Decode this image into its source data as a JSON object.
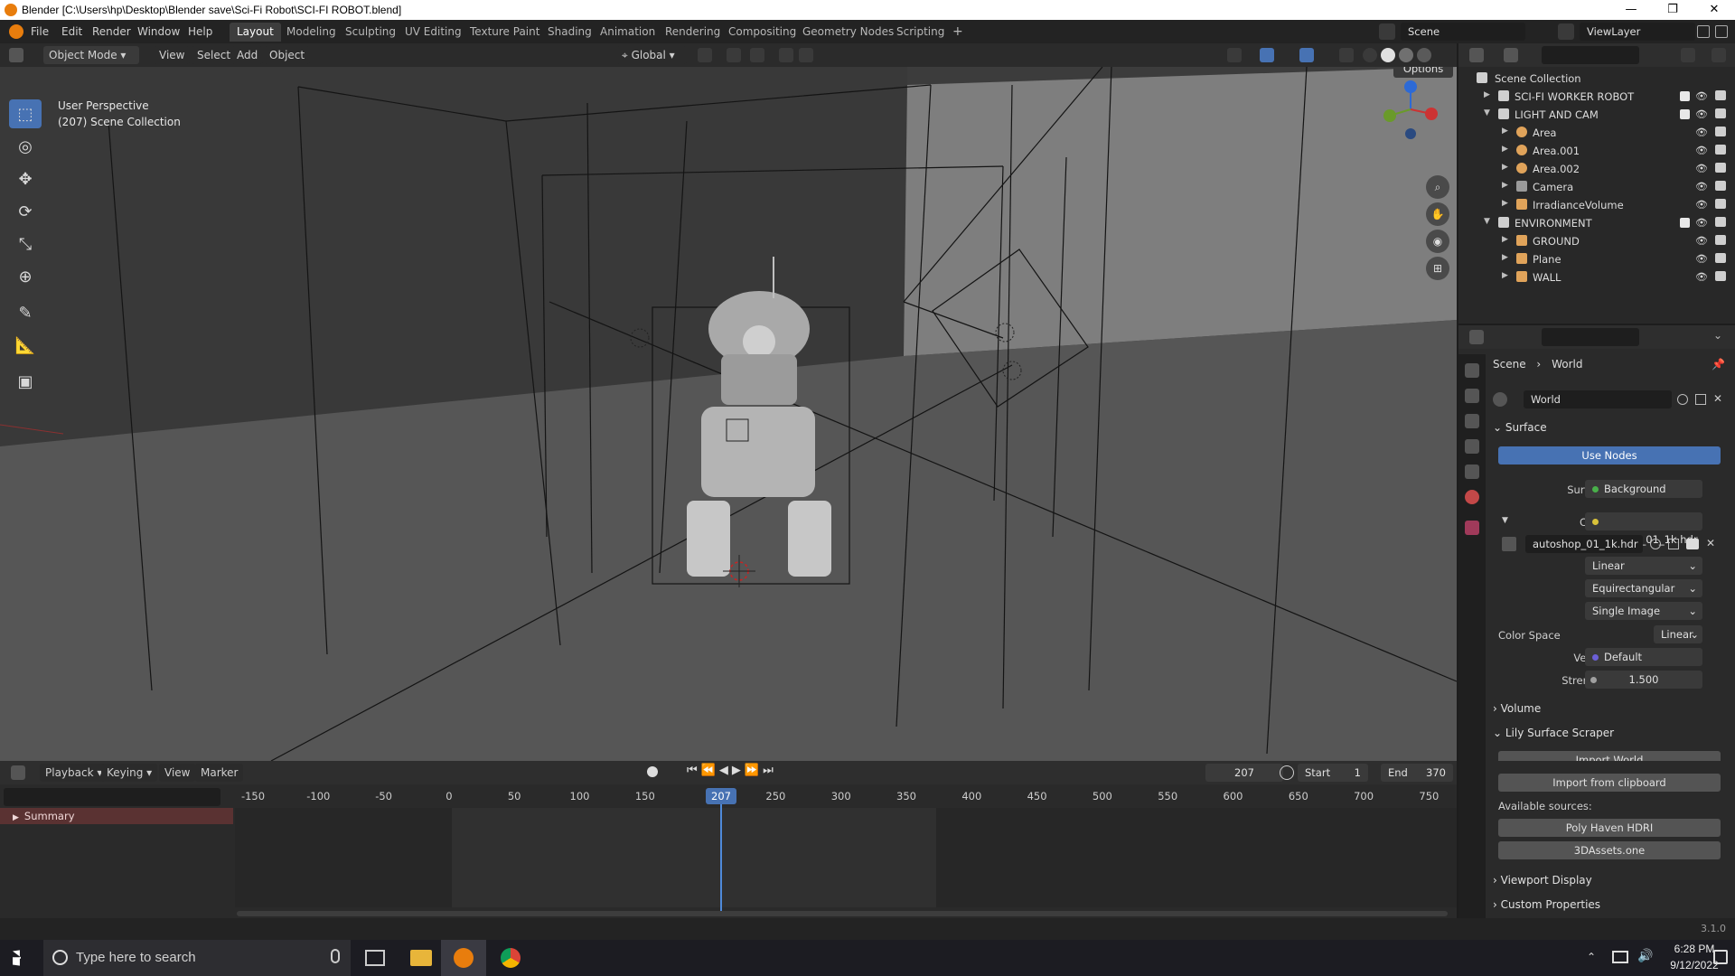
{
  "window": {
    "title": "Blender [C:\\Users\\hp\\Desktop\\Blender save\\Sci-Fi Robot\\SCI-FI ROBOT.blend]",
    "min_label": "—",
    "max_label": "❐",
    "close_label": "✕"
  },
  "menu": {
    "items": [
      "File",
      "Edit",
      "Render",
      "Window",
      "Help"
    ]
  },
  "workspaces": {
    "tabs": [
      "Layout",
      "Modeling",
      "Sculpting",
      "UV Editing",
      "Texture Paint",
      "Shading",
      "Animation",
      "Rendering",
      "Compositing",
      "Geometry Nodes",
      "Scripting"
    ],
    "add": "+",
    "active": "Layout"
  },
  "topright": {
    "scene": "Scene",
    "viewlayer": "ViewLayer"
  },
  "viewport_header": {
    "mode": "Object Mode",
    "view": "View",
    "select": "Select",
    "add": "Add",
    "object": "Object",
    "transform": "Global",
    "options": "Options"
  },
  "viewport": {
    "perspective": "User Perspective",
    "collection": "(207) Scene Collection"
  },
  "outliner": {
    "root": "Scene Collection",
    "rows": [
      {
        "name": "SCI-FI WORKER ROBOT",
        "level": 1,
        "kind": "collection",
        "expanded": false
      },
      {
        "name": "LIGHT AND CAM",
        "level": 1,
        "kind": "collection",
        "expanded": true
      },
      {
        "name": "Area",
        "level": 2,
        "kind": "light"
      },
      {
        "name": "Area.001",
        "level": 2,
        "kind": "light"
      },
      {
        "name": "Area.002",
        "level": 2,
        "kind": "light"
      },
      {
        "name": "Camera",
        "level": 2,
        "kind": "camera"
      },
      {
        "name": "IrradianceVolume",
        "level": 2,
        "kind": "probe"
      },
      {
        "name": "ENVIRONMENT",
        "level": 1,
        "kind": "collection",
        "expanded": true
      },
      {
        "name": "GROUND",
        "level": 2,
        "kind": "mesh"
      },
      {
        "name": "Plane",
        "level": 2,
        "kind": "mesh"
      },
      {
        "name": "WALL",
        "level": 2,
        "kind": "mesh"
      }
    ]
  },
  "properties": {
    "breadcrumb": {
      "scene": "Scene",
      "sep": "›",
      "world": "World"
    },
    "world_name": "World",
    "surface_panel": "Surface",
    "use_nodes": "Use Nodes",
    "surface_label": "Surface",
    "surface_value": "Background",
    "color_label": "Color",
    "color_value": "autoshop_01_1k.hdr",
    "image_name": "autoshop_01_1k.hdr",
    "interpolation": "Linear",
    "projection": "Equirectangular",
    "source": "Single Image",
    "color_space_label": "Color Space",
    "color_space": "Linear",
    "vector_label": "Vector",
    "vector_value": "Default",
    "strength_label": "Strength",
    "strength_value": "1.500",
    "volume_panel": "Volume",
    "lily_panel": "Lily Surface Scraper",
    "import_world": "Import World",
    "import_clipboard": "Import from clipboard",
    "available_sources": "Available sources:",
    "source_1": "Poly Haven HDRI",
    "source_2": "3DAssets.one",
    "viewport_display": "Viewport Display",
    "custom_properties": "Custom Properties"
  },
  "timeline": {
    "playback": "Playback",
    "keying": "Keying",
    "view": "View",
    "marker": "Marker",
    "current_frame": "207",
    "start_label": "Start",
    "start": "1",
    "end_label": "End",
    "end": "370",
    "ruler": [
      "-150",
      "-100",
      "-50",
      "0",
      "50",
      "100",
      "150",
      "2",
      "250",
      "300",
      "350",
      "400",
      "450",
      "500",
      "550",
      "600",
      "650",
      "700",
      "750"
    ],
    "playhead_label": "207",
    "summary": "Summary"
  },
  "status": {
    "version": "3.1.0"
  },
  "taskbar": {
    "search_placeholder": "Type here to search",
    "time": "6:28 PM",
    "date": "9/12/2022"
  }
}
